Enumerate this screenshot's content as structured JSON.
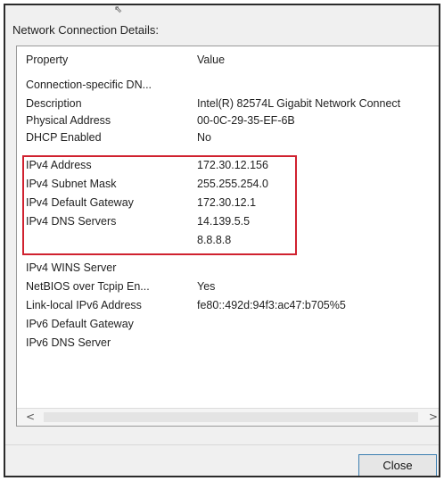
{
  "dialog": {
    "title": "Network Connection Details:"
  },
  "columns": {
    "property": "Property",
    "value": "Value"
  },
  "rows": [
    {
      "property": "Connection-specific DN...",
      "value": ""
    },
    {
      "property": "Description",
      "value": "Intel(R) 82574L Gigabit Network Connect"
    },
    {
      "property": "Physical Address",
      "value": "00-0C-29-35-EF-6B"
    },
    {
      "property": "DHCP Enabled",
      "value": "No"
    },
    {
      "property": "IPv4 Address",
      "value": "172.30.12.156"
    },
    {
      "property": "IPv4 Subnet Mask",
      "value": "255.255.254.0"
    },
    {
      "property": "IPv4 Default Gateway",
      "value": "172.30.12.1"
    },
    {
      "property": "IPv4 DNS Servers",
      "value": "14.139.5.5"
    },
    {
      "property": "",
      "value": "8.8.8.8"
    },
    {
      "property": "IPv4 WINS Server",
      "value": ""
    },
    {
      "property": "NetBIOS over Tcpip En...",
      "value": "Yes"
    },
    {
      "property": "Link-local IPv6 Address",
      "value": "fe80::492d:94f3:ac47:b705%5"
    },
    {
      "property": "IPv6 Default Gateway",
      "value": ""
    },
    {
      "property": "IPv6 DNS Server",
      "value": ""
    }
  ],
  "scrollbar": {
    "left_arrow": "<",
    "right_arrow": ">"
  },
  "buttons": {
    "close_label": "Close"
  },
  "highlight_color": "#d0212f"
}
